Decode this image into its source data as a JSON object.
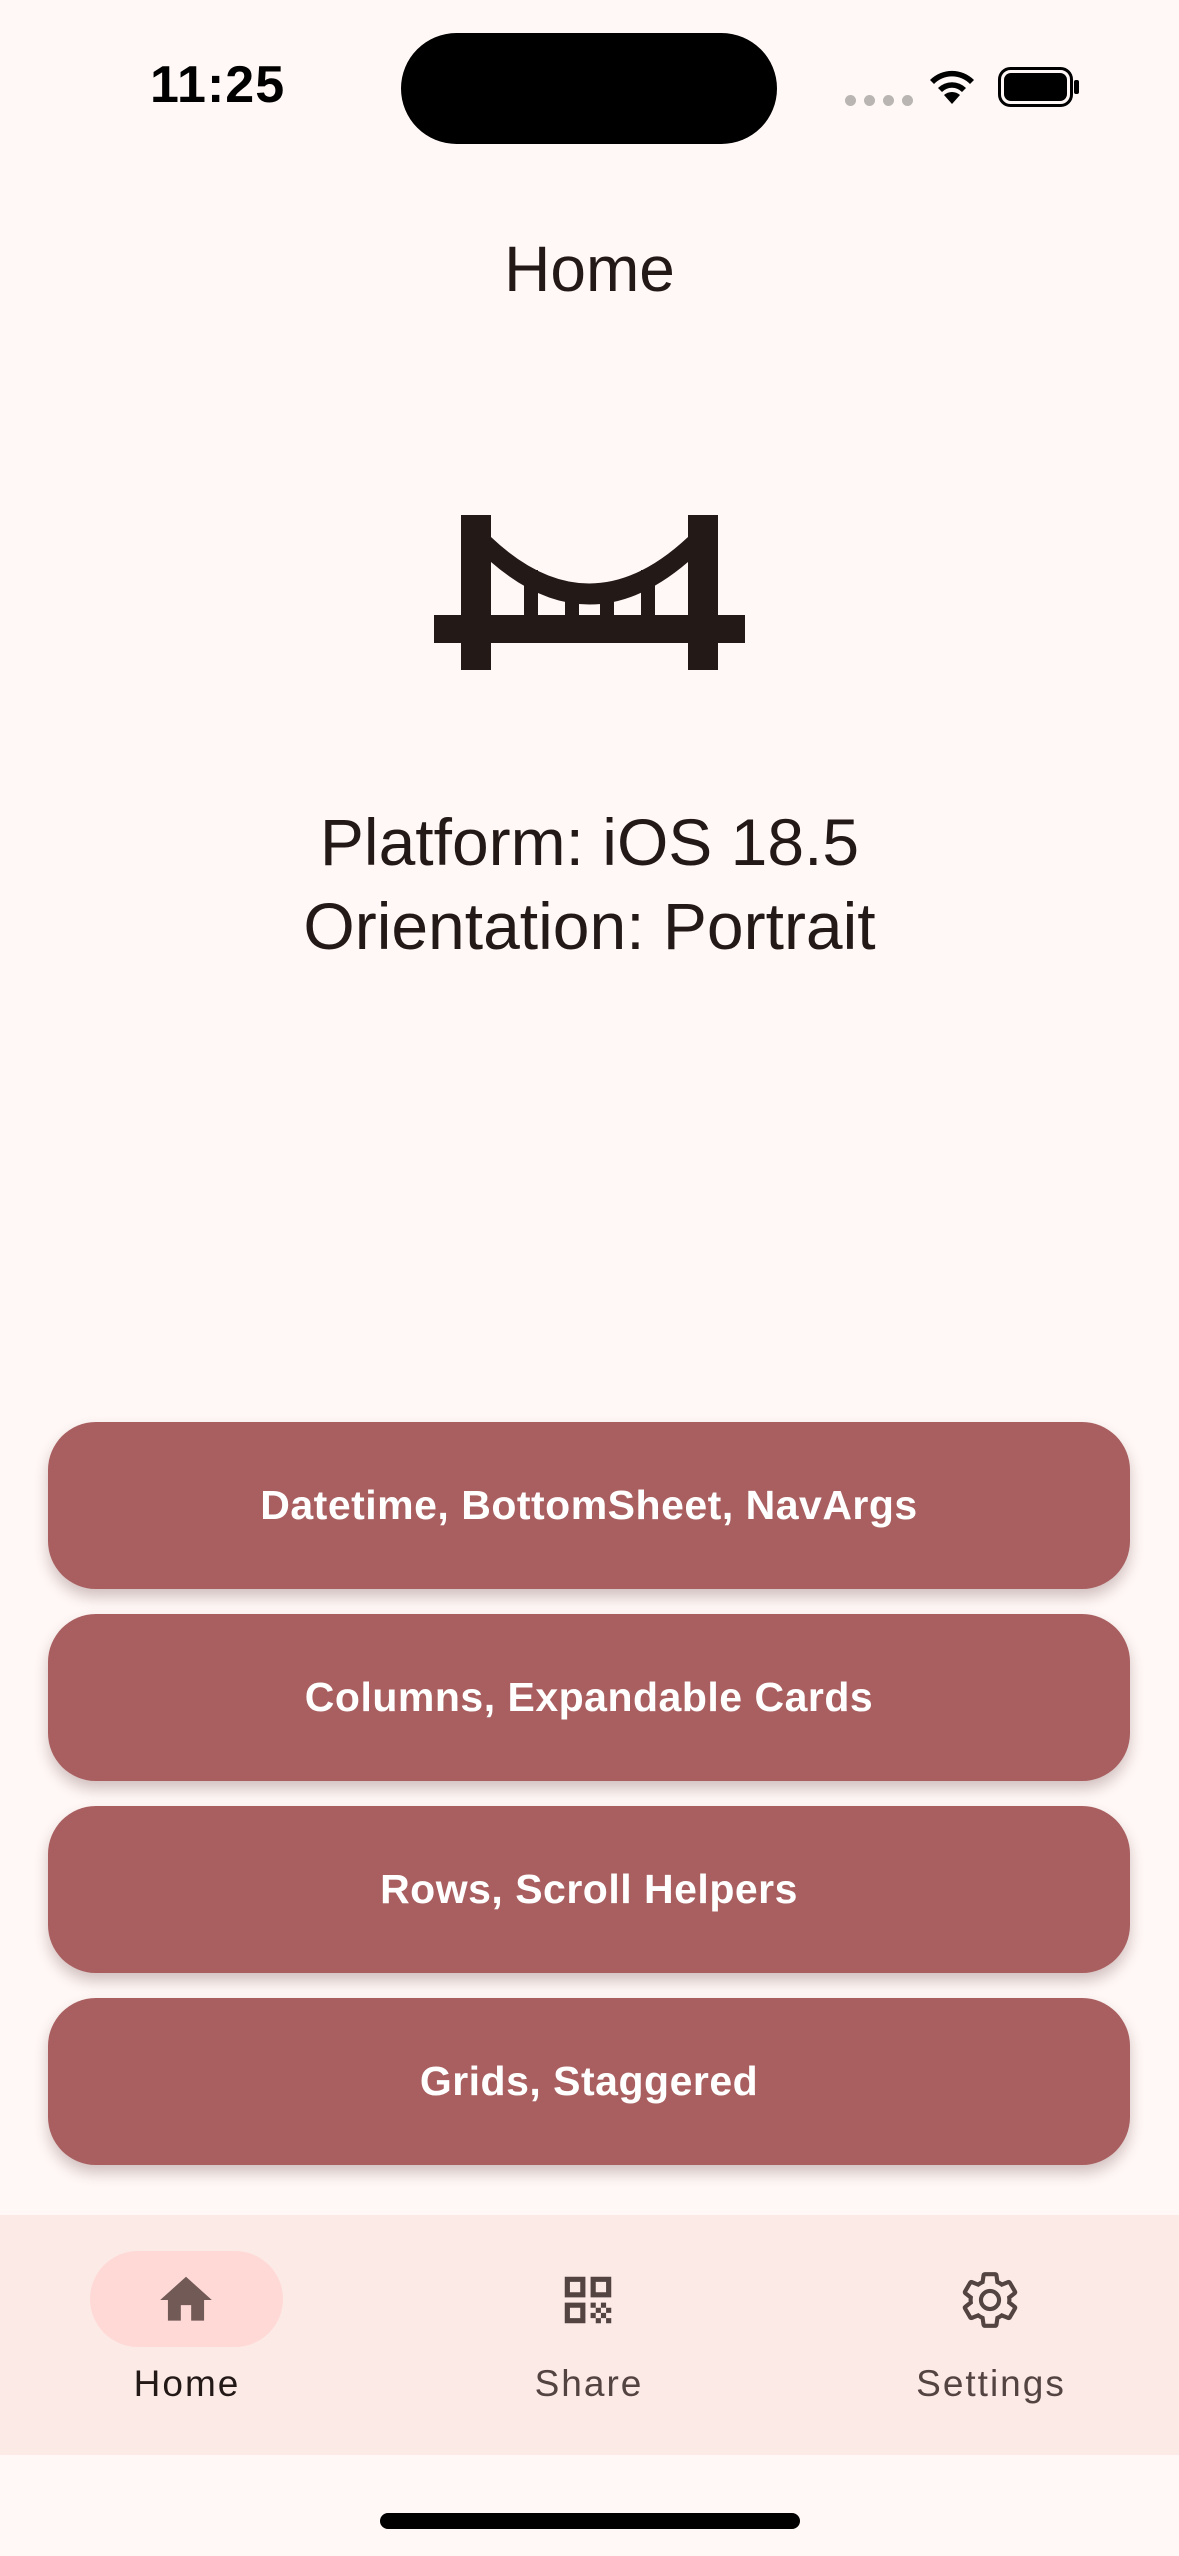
{
  "status_bar": {
    "time": "11:25"
  },
  "header": {
    "title": "Home"
  },
  "main": {
    "icon": "bridge-icon",
    "platform_text": "Platform: iOS 18.5",
    "orientation_text": "Orientation: Portrait"
  },
  "buttons": [
    {
      "label": "Datetime, BottomSheet, NavArgs"
    },
    {
      "label": "Columns, Expandable Cards"
    },
    {
      "label": "Rows, Scroll Helpers"
    },
    {
      "label": "Grids, Staggered"
    }
  ],
  "bottom_nav": {
    "items": [
      {
        "label": "Home",
        "icon": "home-icon",
        "selected": true
      },
      {
        "label": "Share",
        "icon": "qr-code-icon",
        "selected": false
      },
      {
        "label": "Settings",
        "icon": "gear-icon",
        "selected": false
      }
    ]
  },
  "colors": {
    "background": "#fff8f6",
    "button": "#a95f60",
    "nav_background": "#fceae7",
    "nav_active_pill": "#ffd9d6"
  }
}
